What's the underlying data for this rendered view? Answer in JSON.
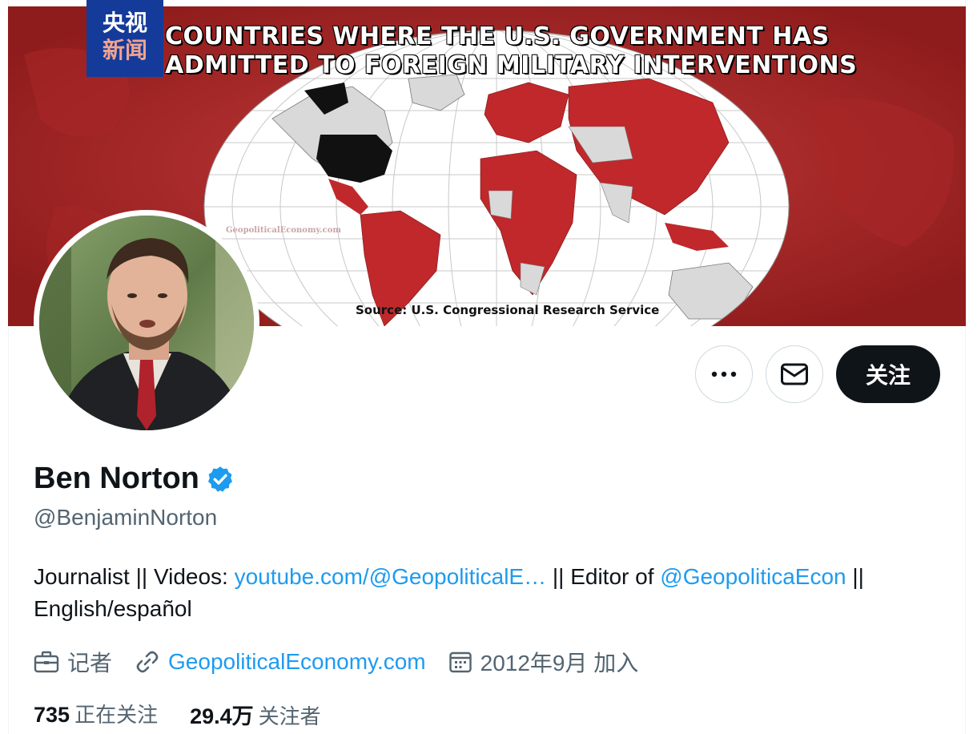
{
  "banner": {
    "title_line1": "COUNTRIES WHERE THE U.S. GOVERNMENT HAS",
    "title_line2": "ADMITTED TO FOREIGN MILITARY INTERVENTIONS",
    "source": "Source: U.S. Congressional Research Service",
    "watermark": "GeopoliticalEconomy.com",
    "colors": {
      "background": "#b42a2a",
      "highlight": "#c0282b",
      "usa": "#111111",
      "other": "#d9d9d9"
    }
  },
  "cctv_logo": {
    "line1": "央视",
    "line2": "新闻"
  },
  "actions": {
    "more_icon": "more-horizontal-icon",
    "message_icon": "envelope-icon",
    "follow_label": "关注"
  },
  "profile": {
    "name": "Ben Norton",
    "verified_icon": "verified-badge-icon",
    "handle": "@BenjaminNorton",
    "bio": {
      "part1": "Journalist || Videos: ",
      "link1": "youtube.com/@GeopoliticalE…",
      "part2": " || Editor of ",
      "link2": "@GeopoliticaEcon",
      "part3": " || English/español"
    },
    "meta": {
      "profession": "记者",
      "website": "GeopoliticalEconomy.com",
      "joined": "2012年9月 加入"
    },
    "stats": {
      "following_count": "735",
      "following_label": "正在关注",
      "followers_count": "29.4万",
      "followers_label": "关注者"
    }
  },
  "accent_color": "#1d9bf0"
}
